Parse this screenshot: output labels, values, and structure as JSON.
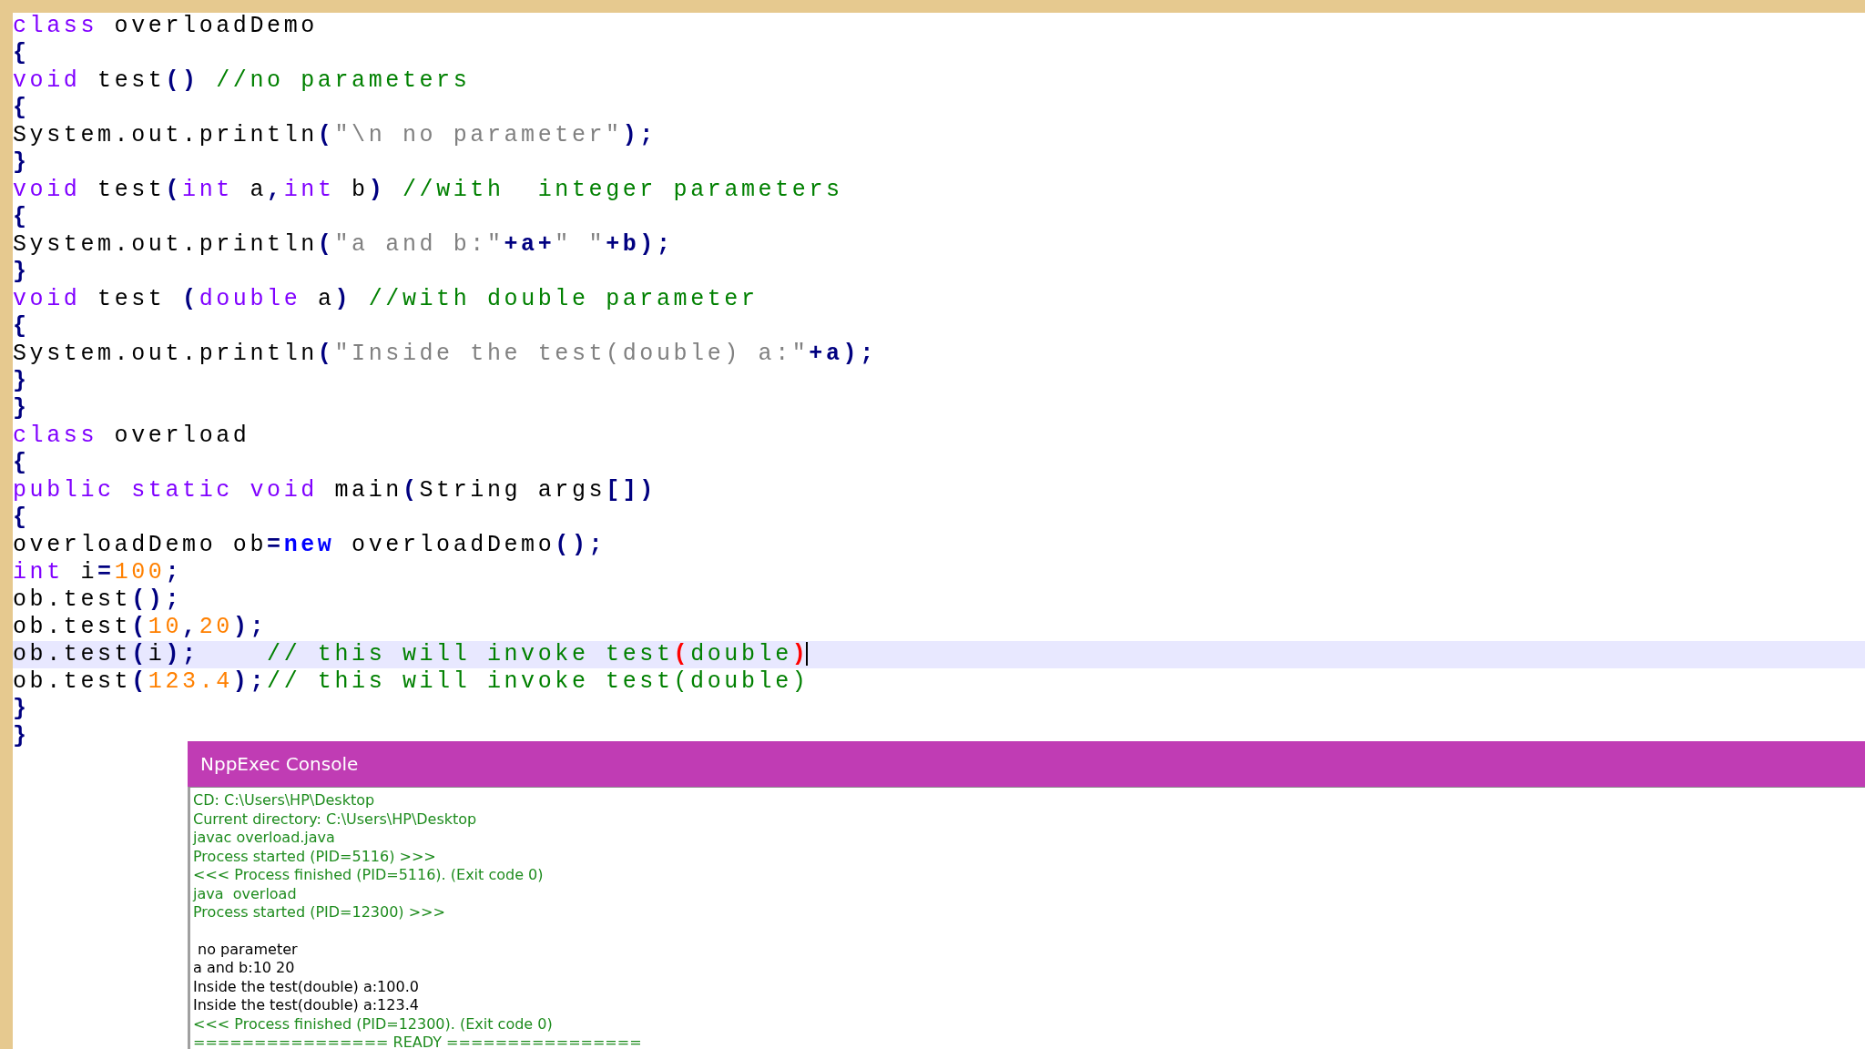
{
  "editor": {
    "lines": [
      {
        "current": false,
        "tokens": [
          {
            "t": "class",
            "kind": "kw"
          },
          {
            "t": " overloadDemo",
            "kind": "plain"
          }
        ]
      },
      {
        "current": false,
        "tokens": [
          {
            "t": "{",
            "kind": "op"
          }
        ]
      },
      {
        "current": false,
        "tokens": [
          {
            "t": "void",
            "kind": "kw"
          },
          {
            "t": " test",
            "kind": "plain"
          },
          {
            "t": "()",
            "kind": "op"
          },
          {
            "t": " //no parameters",
            "kind": "comment"
          }
        ]
      },
      {
        "current": false,
        "tokens": [
          {
            "t": "{",
            "kind": "op"
          }
        ]
      },
      {
        "current": false,
        "tokens": [
          {
            "t": "System.out.println",
            "kind": "plain"
          },
          {
            "t": "(",
            "kind": "op"
          },
          {
            "t": "\"\\n no parameter\"",
            "kind": "str"
          },
          {
            "t": ");",
            "kind": "op"
          }
        ]
      },
      {
        "current": false,
        "tokens": [
          {
            "t": "}",
            "kind": "op"
          }
        ]
      },
      {
        "current": false,
        "tokens": [
          {
            "t": "void",
            "kind": "kw"
          },
          {
            "t": " test",
            "kind": "plain"
          },
          {
            "t": "(",
            "kind": "op"
          },
          {
            "t": "int",
            "kind": "kw"
          },
          {
            "t": " a",
            "kind": "plain"
          },
          {
            "t": ",",
            "kind": "op"
          },
          {
            "t": "int",
            "kind": "kw"
          },
          {
            "t": " b",
            "kind": "plain"
          },
          {
            "t": ")",
            "kind": "op"
          },
          {
            "t": " //with  integer parameters",
            "kind": "comment"
          }
        ]
      },
      {
        "current": false,
        "tokens": [
          {
            "t": "{",
            "kind": "op"
          }
        ]
      },
      {
        "current": false,
        "tokens": [
          {
            "t": "System.out.println",
            "kind": "plain"
          },
          {
            "t": "(",
            "kind": "op"
          },
          {
            "t": "\"a and b:\"",
            "kind": "str"
          },
          {
            "t": "+a+",
            "kind": "op"
          },
          {
            "t": "\" \"",
            "kind": "str"
          },
          {
            "t": "+b);",
            "kind": "op"
          }
        ]
      },
      {
        "current": false,
        "tokens": [
          {
            "t": "}",
            "kind": "op"
          }
        ]
      },
      {
        "current": false,
        "tokens": [
          {
            "t": "void",
            "kind": "kw"
          },
          {
            "t": " test ",
            "kind": "plain"
          },
          {
            "t": "(",
            "kind": "op"
          },
          {
            "t": "double",
            "kind": "kw"
          },
          {
            "t": " a",
            "kind": "plain"
          },
          {
            "t": ")",
            "kind": "op"
          },
          {
            "t": " //with double parameter",
            "kind": "comment"
          }
        ]
      },
      {
        "current": false,
        "tokens": [
          {
            "t": "{",
            "kind": "op"
          }
        ]
      },
      {
        "current": false,
        "tokens": [
          {
            "t": "System.out.println",
            "kind": "plain"
          },
          {
            "t": "(",
            "kind": "op"
          },
          {
            "t": "\"Inside the test(double) a:\"",
            "kind": "str"
          },
          {
            "t": "+a);",
            "kind": "op"
          }
        ]
      },
      {
        "current": false,
        "tokens": [
          {
            "t": "}",
            "kind": "op"
          }
        ]
      },
      {
        "current": false,
        "tokens": [
          {
            "t": "}",
            "kind": "op"
          }
        ]
      },
      {
        "current": false,
        "tokens": [
          {
            "t": "class",
            "kind": "kw"
          },
          {
            "t": " overload",
            "kind": "plain"
          }
        ]
      },
      {
        "current": false,
        "tokens": [
          {
            "t": "{",
            "kind": "op"
          }
        ]
      },
      {
        "current": false,
        "tokens": [
          {
            "t": "public static void",
            "kind": "kw"
          },
          {
            "t": " main",
            "kind": "plain"
          },
          {
            "t": "(",
            "kind": "op"
          },
          {
            "t": "String args",
            "kind": "plain"
          },
          {
            "t": "[])",
            "kind": "op"
          }
        ]
      },
      {
        "current": false,
        "tokens": [
          {
            "t": "{",
            "kind": "op"
          }
        ]
      },
      {
        "current": false,
        "tokens": [
          {
            "t": "overloadDemo ob",
            "kind": "plain"
          },
          {
            "t": "=",
            "kind": "op"
          },
          {
            "t": "new",
            "kind": "new"
          },
          {
            "t": " overloadDemo",
            "kind": "plain"
          },
          {
            "t": "();",
            "kind": "op"
          }
        ]
      },
      {
        "current": false,
        "tokens": [
          {
            "t": "int",
            "kind": "kw"
          },
          {
            "t": " i",
            "kind": "plain"
          },
          {
            "t": "=",
            "kind": "op"
          },
          {
            "t": "100",
            "kind": "num"
          },
          {
            "t": ";",
            "kind": "op"
          }
        ]
      },
      {
        "current": false,
        "tokens": [
          {
            "t": "ob.test",
            "kind": "plain"
          },
          {
            "t": "();",
            "kind": "op"
          }
        ]
      },
      {
        "current": false,
        "tokens": [
          {
            "t": "ob.test",
            "kind": "plain"
          },
          {
            "t": "(",
            "kind": "op"
          },
          {
            "t": "10",
            "kind": "num"
          },
          {
            "t": ",",
            "kind": "op"
          },
          {
            "t": "20",
            "kind": "num"
          },
          {
            "t": ");",
            "kind": "op"
          }
        ]
      },
      {
        "current": true,
        "tokens": [
          {
            "t": "ob.test",
            "kind": "plain"
          },
          {
            "t": "(",
            "kind": "op"
          },
          {
            "t": "i",
            "kind": "plain"
          },
          {
            "t": ");",
            "kind": "op"
          },
          {
            "t": "    // this will invoke test",
            "kind": "comment"
          },
          {
            "t": "(",
            "kind": "match"
          },
          {
            "t": "double",
            "kind": "comment"
          },
          {
            "t": ")",
            "kind": "match"
          }
        ]
      },
      {
        "current": false,
        "tokens": [
          {
            "t": "ob.test",
            "kind": "plain"
          },
          {
            "t": "(",
            "kind": "op"
          },
          {
            "t": "123.4",
            "kind": "num"
          },
          {
            "t": ");",
            "kind": "op"
          },
          {
            "t": "// this will invoke test(double)",
            "kind": "comment"
          }
        ]
      },
      {
        "current": false,
        "tokens": [
          {
            "t": "}",
            "kind": "op"
          }
        ]
      },
      {
        "current": false,
        "tokens": [
          {
            "t": "}",
            "kind": "op"
          }
        ]
      }
    ]
  },
  "console": {
    "title": "NppExec Console",
    "lines": [
      {
        "text": "CD: C:\\Users\\HP\\Desktop",
        "kind": "system",
        "gap_before": false
      },
      {
        "text": "Current directory: C:\\Users\\HP\\Desktop",
        "kind": "system",
        "gap_before": false
      },
      {
        "text": "javac overload.java",
        "kind": "system",
        "gap_before": false
      },
      {
        "text": "Process started (PID=5116) >>>",
        "kind": "system",
        "gap_before": false
      },
      {
        "text": "<<< Process finished (PID=5116). (Exit code 0)",
        "kind": "system",
        "gap_before": false
      },
      {
        "text": "java  overload",
        "kind": "system",
        "gap_before": false
      },
      {
        "text": "Process started (PID=12300) >>>",
        "kind": "system",
        "gap_before": false
      },
      {
        "text": " no parameter",
        "kind": "output",
        "gap_before": true
      },
      {
        "text": "a and b:10 20",
        "kind": "output",
        "gap_before": false
      },
      {
        "text": "Inside the test(double) a:100.0",
        "kind": "output",
        "gap_before": false
      },
      {
        "text": "Inside the test(double) a:123.4",
        "kind": "output",
        "gap_before": false
      },
      {
        "text": "<<< Process finished (PID=12300). (Exit code 0)",
        "kind": "system",
        "gap_before": false
      },
      {
        "text": "================ READY ================",
        "kind": "system",
        "gap_before": false
      }
    ]
  }
}
